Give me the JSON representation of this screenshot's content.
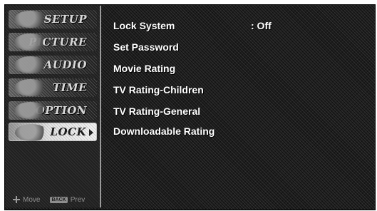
{
  "menu": {
    "items": [
      {
        "label": "SETUP",
        "icon": "setup-thumbnail-icon"
      },
      {
        "label": "PICTURE",
        "icon": "picture-thumbnail-icon"
      },
      {
        "label": "AUDIO",
        "icon": "audio-thumbnail-icon"
      },
      {
        "label": "TIME",
        "icon": "time-thumbnail-icon"
      },
      {
        "label": "OPTION",
        "icon": "option-thumbnail-icon"
      },
      {
        "label": "LOCK",
        "icon": "lock-thumbnail-icon",
        "selected": true
      }
    ],
    "footer": {
      "move_icon": "directional-pad-icon",
      "move_label": "Move",
      "back_key": "BACK",
      "prev_label": "Prev"
    }
  },
  "lock_menu": {
    "options": [
      {
        "label": "Lock System",
        "value": ": Off"
      },
      {
        "label": "Set Password"
      },
      {
        "label": "Movie Rating"
      },
      {
        "label": "TV Rating-Children"
      },
      {
        "label": "TV Rating-General"
      },
      {
        "label": "Downloadable Rating"
      }
    ]
  },
  "colors": {
    "background": "#1a1a1a",
    "text": "#ffffff",
    "menu_text": "#d8d8d8",
    "selected_item": "#e6e6e6"
  }
}
